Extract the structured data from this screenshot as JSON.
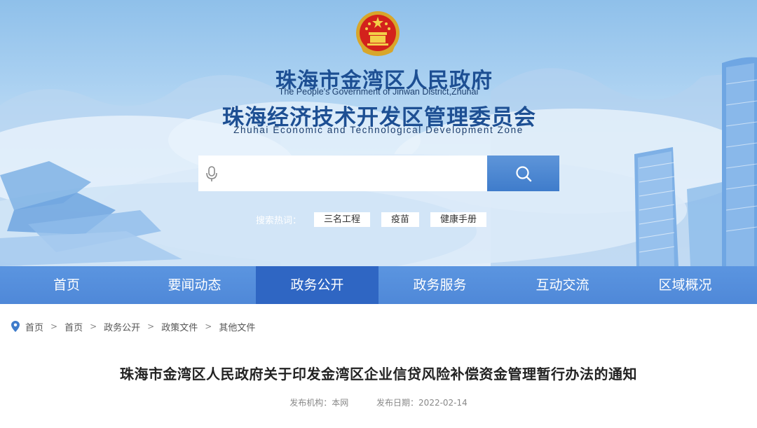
{
  "header": {
    "title_cn": "珠海市金湾区人民政府",
    "title_en": "The People's Government of Jinwan District,Zhuhai",
    "subtitle_cn": "珠海经济技术开发区管理委员会",
    "subtitle_en": "Zhuhai Economic and Technological Development Zone"
  },
  "search": {
    "placeholder": "",
    "value": "",
    "hot_label": "搜索热词：",
    "hot_words": [
      "三名工程",
      "疫苗",
      "健康手册"
    ]
  },
  "nav": {
    "items": [
      "首页",
      "要闻动态",
      "政务公开",
      "政务服务",
      "互动交流",
      "区域概况"
    ],
    "active": "政务公开"
  },
  "breadcrumb": [
    "首页",
    "首页",
    "政务公开",
    "政策文件",
    "其他文件"
  ],
  "article": {
    "title": "珠海市金湾区人民政府关于印发金湾区企业信贷风险补偿资金管理暂行办法的通知",
    "publisher": "发布机构：本网",
    "date": "发布日期：2022-02-14"
  },
  "colors": {
    "nav_bg": "#4f88d8",
    "nav_active": "#2f66c3",
    "title_blue": "#1d4f93",
    "search_btn": "#3f7ccb"
  }
}
